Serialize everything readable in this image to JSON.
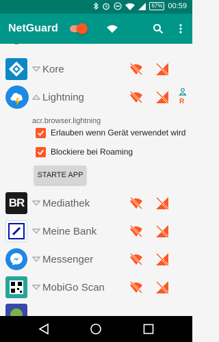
{
  "statusbar": {
    "battery": "67",
    "time": "00:59"
  },
  "toolbar": {
    "title": "NetGuard"
  },
  "apps": [
    {
      "name": "Kore"
    },
    {
      "name": "Lightning",
      "package": "acr.browser.lightning",
      "indicator": "R",
      "options": [
        "Erlauben wenn Gerät verwendet wird",
        "Blockiere bei Roaming"
      ],
      "button": "STARTE APP"
    },
    {
      "name": "Mediathek",
      "icon_text": "BR"
    },
    {
      "name": "Meine Bank"
    },
    {
      "name": "Messenger"
    },
    {
      "name": "MobiGo Scan"
    }
  ],
  "colors": {
    "primary": "#009688",
    "primary_dark": "#00796b",
    "accent": "#ff5722"
  }
}
